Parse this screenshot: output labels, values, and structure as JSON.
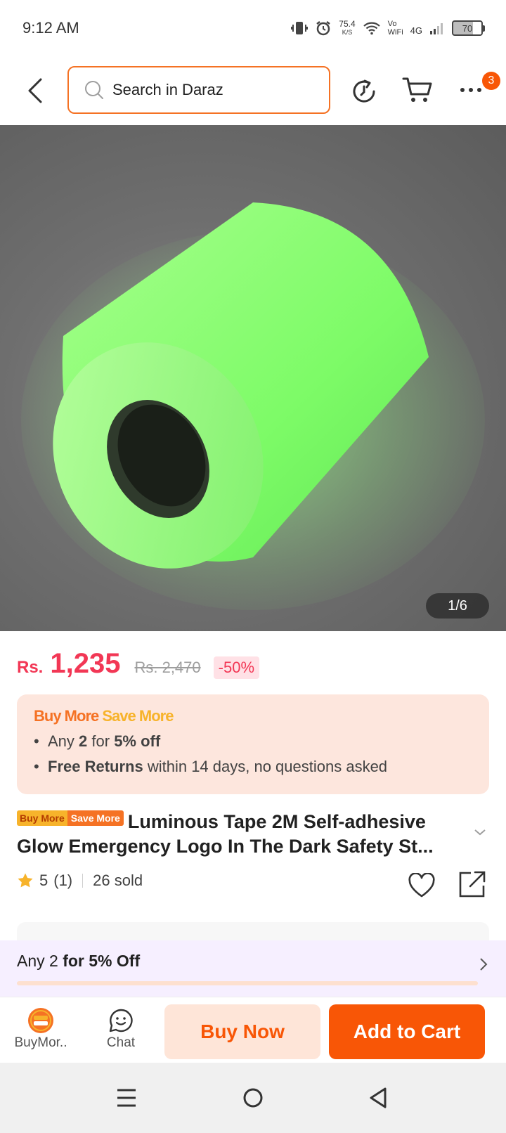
{
  "status_bar": {
    "time": "9:12 AM",
    "net_speed": "75.4",
    "net_unit": "K/S",
    "vo": "Vo",
    "wifi_label": "WiFi",
    "network": "4G",
    "battery": "70"
  },
  "header": {
    "search_placeholder": "Search in Daraz",
    "cart_badge": "3"
  },
  "gallery": {
    "counter": "1/6"
  },
  "price": {
    "currency": "Rs.",
    "current": "1,235",
    "original": "Rs. 2,470",
    "discount": "-50%"
  },
  "promo_card": {
    "title_buy": "Buy More",
    "title_save": "Save More",
    "line1_pre": "Any ",
    "line1_num": "2",
    "line1_mid": " for ",
    "line1_bold": "5% off",
    "line2_bold": "Free Returns",
    "line2_rest": " within 14 days, no questions asked"
  },
  "product": {
    "badge_a": "Buy More",
    "badge_b": "Save More",
    "title": "Luminous Tape 2M Self-adhesive Glow Emergency Logo In The Dark Safety St...",
    "rating": "5",
    "rating_count": "(1)",
    "sold": "26 sold"
  },
  "promo_bar": {
    "text_pre": "Any 2 ",
    "text_bold": "for 5% Off"
  },
  "actions": {
    "buymore_label": "BuyMor..",
    "chat_label": "Chat",
    "buy_now": "Buy Now",
    "add_to_cart": "Add to Cart"
  },
  "colors": {
    "brand": "#f85606",
    "price": "#f23755",
    "search_border": "#f57224"
  }
}
